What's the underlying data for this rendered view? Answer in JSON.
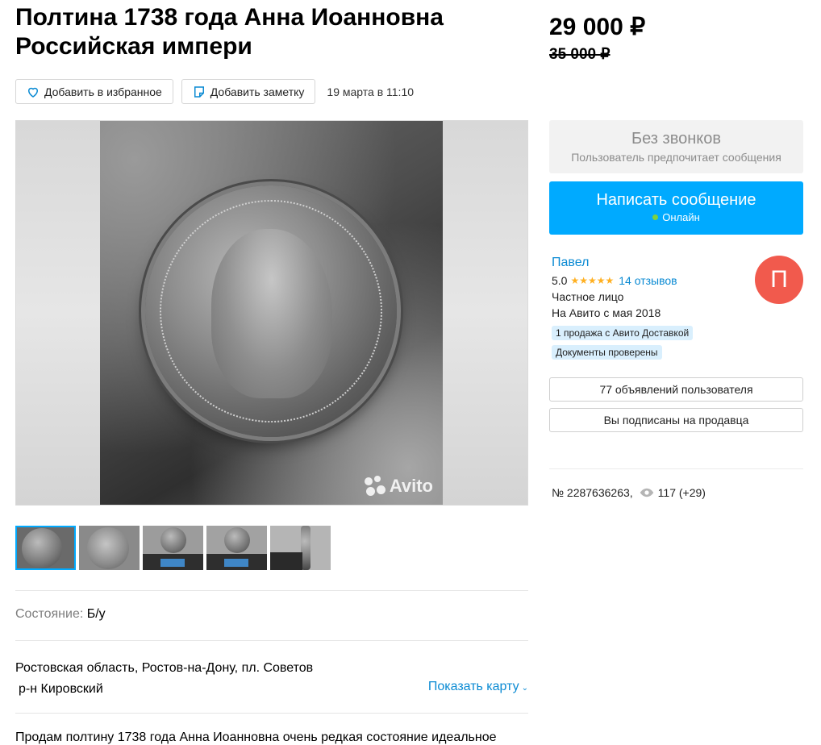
{
  "listing": {
    "title": "Полтина 1738 года Анна Иоанновна Российская импери",
    "price": "29 000 ₽",
    "old_price": "35 000 ₽",
    "date": "19 марта в 11:10",
    "favorite_label": "Добавить в избранное",
    "note_label": "Добавить заметку"
  },
  "gallery": {
    "watermark": "Avito",
    "thumbnail_count": 5,
    "active_thumbnail": 1
  },
  "details": {
    "condition_label": "Состояние:",
    "condition_value": "Б/у",
    "address_line1": "Ростовская область, Ростов-на-Дону, пл. Советов",
    "address_line2": "р-н Кировский",
    "map_link": "Показать карту",
    "description": "Продам полтину 1738 года Анна Иоанновна очень редкая состояние идеальное"
  },
  "contact": {
    "no_calls_title": "Без звонков",
    "no_calls_subtitle": "Пользователь предпочитает сообщения",
    "write_button": "Написать сообщение",
    "online_status": "Онлайн"
  },
  "seller": {
    "name": "Павел",
    "rating": "5.0",
    "stars": "★★★★★",
    "reviews": "14 отзывов",
    "type": "Частное лицо",
    "since": "На Авито с мая 2018",
    "badge_delivery": "1 продажа с Авито Доставкой",
    "badge_docs": "Документы проверены",
    "avatar_letter": "П",
    "listings_button": "77 объявлений пользователя",
    "subscribed_button": "Вы подписаны на продавца"
  },
  "meta": {
    "ad_number": "№ 2287636263,",
    "views": "117 (+29)"
  },
  "colors": {
    "accent": "#00aaff",
    "link": "#0a8ad3",
    "avatar": "#f15a4d",
    "stars": "#ffb021",
    "online_dot": "#7cd13f",
    "badge_bg": "#d9effd"
  }
}
